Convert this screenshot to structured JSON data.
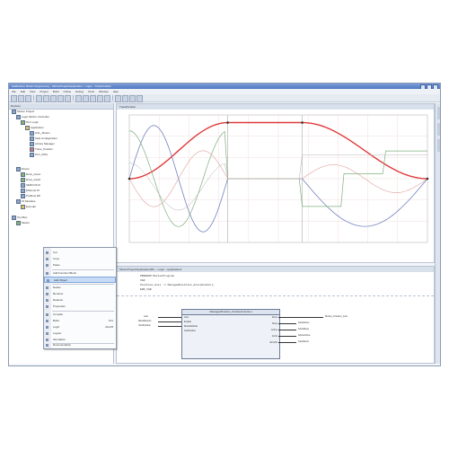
{
  "window": {
    "title": "SoMachine Motion Engineering – MotionProject/Application – Logic – TracePosition"
  },
  "menubar": [
    "File",
    "Edit",
    "View",
    "Project",
    "Build",
    "Online",
    "Debug",
    "Tools",
    "Window",
    "Help"
  ],
  "tree": {
    "header": "Devices",
    "items": [
      {
        "label": "Motion Project",
        "depth": 0,
        "icon": "b"
      },
      {
        "label": "Logic Motion Controller",
        "depth": 1,
        "icon": "b"
      },
      {
        "label": "PLC Logic",
        "depth": 2,
        "icon": "g"
      },
      {
        "label": "Application",
        "depth": 3,
        "icon": "y"
      },
      {
        "label": "GVL_Motion",
        "depth": 4,
        "icon": "b"
      },
      {
        "label": "Task Configuration",
        "depth": 4,
        "icon": "b"
      },
      {
        "label": "Library Manager",
        "depth": 4,
        "icon": "b"
      },
      {
        "label": "Trace_Position",
        "depth": 4,
        "icon": "r"
      },
      {
        "label": "PLC_PRG",
        "depth": 4,
        "icon": "b"
      },
      {
        "label": "Drives",
        "depth": 1,
        "icon": "b"
      },
      {
        "label": "Drive_Axis1",
        "depth": 2,
        "icon": "g"
      },
      {
        "label": "Drive_Axis2",
        "depth": 2,
        "icon": "g"
      },
      {
        "label": "SERCOS III",
        "depth": 2,
        "icon": "b"
      },
      {
        "label": "Ethernet IP",
        "depth": 2,
        "icon": "b"
      },
      {
        "label": "Profibus DP",
        "depth": 2,
        "icon": "b"
      },
      {
        "label": "IO Modules",
        "depth": 1,
        "icon": "b"
      },
      {
        "label": "Encoder",
        "depth": 2,
        "icon": "y"
      },
      {
        "label": "Tool Box",
        "depth": 0,
        "icon": "b"
      },
      {
        "label": "Motion",
        "depth": 1,
        "icon": "g"
      }
    ]
  },
  "context_menu": {
    "items": [
      {
        "label": "Cut",
        "shortcut": ""
      },
      {
        "label": "Copy",
        "shortcut": ""
      },
      {
        "label": "Paste",
        "shortcut": ""
      },
      {
        "label": "Add Function Block",
        "shortcut": "",
        "sep_before": true
      },
      {
        "label": "Add Object",
        "shortcut": "",
        "highlight": true
      },
      {
        "label": "Delete",
        "shortcut": "",
        "sep_before": true
      },
      {
        "label": "Rename",
        "shortcut": ""
      },
      {
        "label": "Refactor",
        "shortcut": ""
      },
      {
        "label": "Properties",
        "shortcut": ""
      },
      {
        "label": "Compile",
        "shortcut": "",
        "sep_before": true
      },
      {
        "label": "Build",
        "shortcut": "F11"
      },
      {
        "label": "Login",
        "shortcut": "Alt+F8"
      },
      {
        "label": "Logout",
        "shortcut": ""
      },
      {
        "label": "Simulation",
        "shortcut": ""
      },
      {
        "label": "Documentation",
        "shortcut": "",
        "sep_before": true
      }
    ]
  },
  "trace": {
    "tab": "TracePosition",
    "colors": {
      "red": "#e03a3a",
      "blue": "#7282bf",
      "green": "#7fb07f",
      "pink": "#e0a0a0",
      "grey": "#b3b3b3"
    }
  },
  "editor": {
    "tab": "MotionProject/Application/MC – Logic – Application1",
    "code": [
      "PROGRAM MotionProgram",
      "VAR",
      "    Position_Axis := ManagedPosition_Axis(Enable);",
      "END_VAR"
    ],
    "fb": {
      "title": "ManagedPosition_PositionFunction",
      "inputs": [
        "Axis",
        "Enable",
        "ModuleMode",
        "SetPosition"
      ],
      "outputs": [
        "Done",
        "Busy",
        "Active",
        "Error",
        "ErrorID"
      ],
      "in_labels": [
        "Axis",
        "bEnableAxis",
        "rSetPosition"
      ],
      "out_labels": [
        "Motion_Position_Axis",
        "bAxisDone",
        "bAxisBusy",
        "bAxisActive",
        "bAxisError"
      ]
    }
  }
}
